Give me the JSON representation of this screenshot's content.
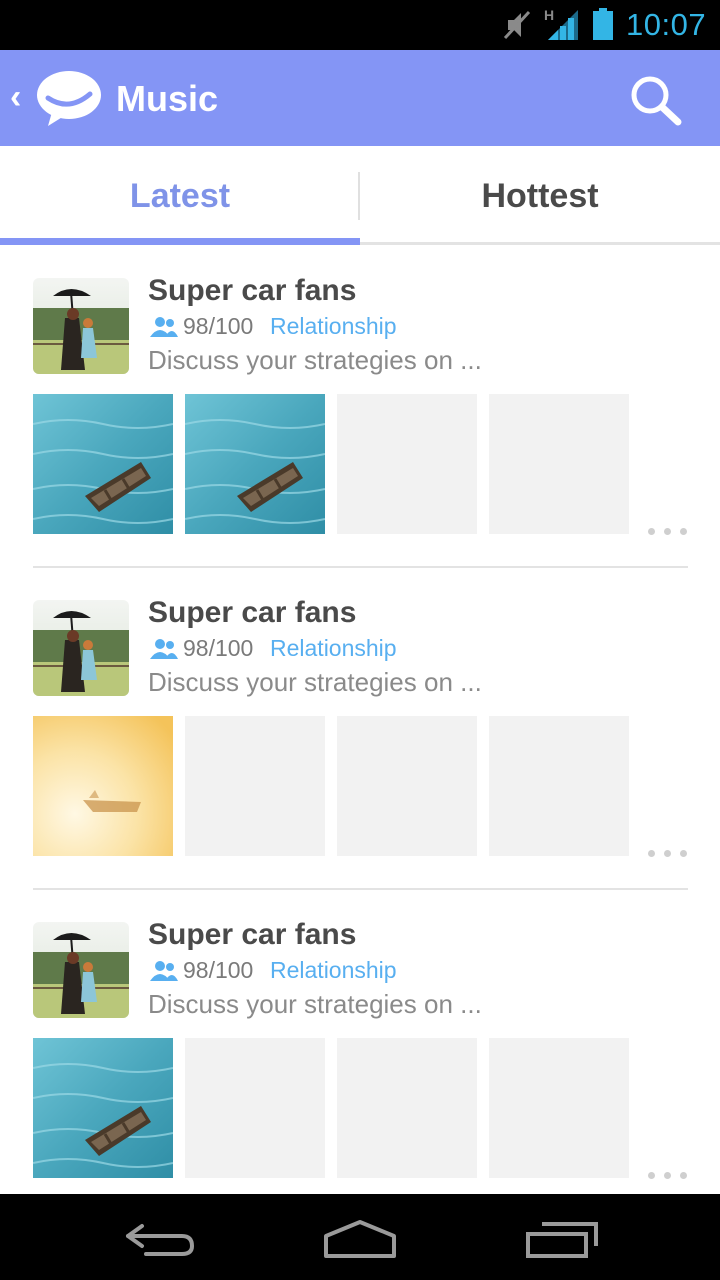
{
  "status_bar": {
    "time": "10:07",
    "network_label": "H",
    "icons": [
      "mute-icon",
      "signal-icon",
      "battery-icon"
    ],
    "accent_color": "#33b5e5"
  },
  "app_bar": {
    "title": "Music",
    "back_icon": "back-chevron-icon",
    "logo_icon": "chat-bubble-logo-icon",
    "search_icon": "search-icon",
    "background_color": "#8495f5"
  },
  "tabs": [
    {
      "label": "Latest",
      "selected": true
    },
    {
      "label": "Hottest",
      "selected": false
    }
  ],
  "groups": [
    {
      "name": "Super car fans",
      "members": "98/100",
      "category": "Relationship",
      "description": "Discuss your strategies on ...",
      "thumbnails": [
        "boat-on-water",
        "boat-on-water",
        "empty",
        "empty"
      ]
    },
    {
      "name": "Super car fans",
      "members": "98/100",
      "category": "Relationship",
      "description": "Discuss your strategies on ...",
      "thumbnails": [
        "boat-in-fog",
        "empty",
        "empty",
        "empty"
      ]
    },
    {
      "name": "Super car fans",
      "members": "98/100",
      "category": "Relationship",
      "description": "Discuss your strategies on ...",
      "thumbnails": [
        "boat-on-water",
        "empty",
        "empty",
        "empty"
      ]
    }
  ],
  "nav_bar": {
    "buttons": [
      "back-icon",
      "home-icon",
      "recent-apps-icon"
    ]
  }
}
